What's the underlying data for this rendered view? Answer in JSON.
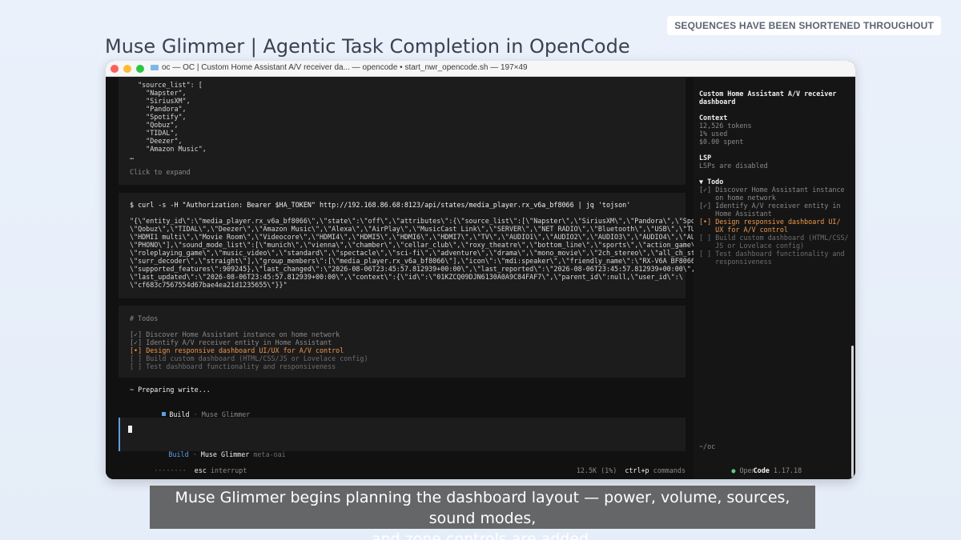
{
  "corner_badge": "SEQUENCES HAVE BEEN SHORTENED THROUGHOUT",
  "page_title": "Muse Glimmer | Agentic Task Completion in OpenCode",
  "window": {
    "title": "oc — OC | Custom Home Assistant A/V receiver da... — opencode • start_nwr_opencode.sh — 197×49"
  },
  "main": {
    "source_block": {
      "lines": "  \"source_list\": [\n    \"Napster\",\n    \"SiriusXM\",\n    \"Pandora\",\n    \"Spotify\",\n    \"Qobuz\",\n    \"TIDAL\",\n    \"Deezer\",\n    \"Amazon Music\",\n…",
      "expand_hint": "Click to expand"
    },
    "curl_block": {
      "command": "$ curl -s -H \"Authorization: Bearer $HA_TOKEN\" http://192.168.86.68:8123/api/states/media_player.rx_v6a_bf8066 | jq 'tojson'",
      "output": "\"{\\\"entity_id\\\":\\\"media_player.rx_v6a_bf8066\\\",\\\"state\\\":\\\"off\\\",\\\"attributes\\\":{\\\"source_list\\\":[\\\"Napster\\\",\\\"SiriusXM\\\",\\\"Pandora\\\",\\\"Spotify\\\",\\\n\\\"Qobuz\\\",\\\"TIDAL\\\",\\\"Deezer\\\",\\\"Amazon Music\\\",\\\"Alexa\\\",\\\"AirPlay\\\",\\\"MusicCast Link\\\",\\\"SERVER\\\",\\\"NET RADIO\\\",\\\"Bluetooth\\\",\\\"USB\\\",\\\"TUNER\\\",\\\n\\\"HDMI1 multi\\\",\\\"Movie Room\\\",\\\"Videocore\\\",\\\"HDMI4\\\",\\\"HDMI5\\\",\\\"HDMI6\\\",\\\"HDMI7\\\",\\\"TV\\\",\\\"AUDIO1\\\",\\\"AUDIO2\\\",\\\"AUDIO3\\\",\\\"AUDIO4\\\",\\\"AUDIO5\\\",\\\n\\\"PHONO\\\"],\\\"sound_mode_list\\\":[\\\"munich\\\",\\\"vienna\\\",\\\"chamber\\\",\\\"cellar_club\\\",\\\"roxy_theatre\\\",\\\"bottom_line\\\",\\\"sports\\\",\\\"action_game\\\",\\\n\\\"roleplaying_game\\\",\\\"music_video\\\",\\\"standard\\\",\\\"spectacle\\\",\\\"sci-fi\\\",\\\"adventure\\\",\\\"drama\\\",\\\"mono_movie\\\",\\\"2ch_stereo\\\",\\\"all_ch_stereo\\\",\\\n\\\"surr_decoder\\\",\\\"straight\\\"],\\\"group_members\\\":[\\\"media_player.rx_v6a_bf8066\\\"],\\\"icon\\\":\\\"mdi:speaker\\\",\\\"friendly_name\\\":\\\"RX-V6A BF8066\\\",\\\n\\\"supported_features\\\":909245},\\\"last_changed\\\":\\\"2026-08-06T23:45:57.812939+00:00\\\",\\\"last_reported\\\":\\\"2026-08-06T23:45:57.812939+00:00\\\",\\\n\\\"last_updated\\\":\\\"2026-08-06T23:45:57.812939+00:00\\\",\\\"context\\\":{\\\"id\\\":\\\"01KZCQ09DJN6130A0A9C84FAF7\\\",\\\"parent_id\\\":null,\\\"user_id\\\":\\\n\\\"cf683c7567554d67bae4ea21d1235655\\\"}}\""
    },
    "todos_block": {
      "heading": "# Todos",
      "items": [
        {
          "mark": "[✓]",
          "text": "Discover Home Assistant instance on home network"
        },
        {
          "mark": "[✓]",
          "text": "Identify A/V receiver entity in Home Assistant"
        },
        {
          "mark": "[•]",
          "text": "Design responsive dashboard UI/UX for A/V control"
        },
        {
          "mark": "[ ]",
          "text": "Build custom dashboard (HTML/CSS/JS or Lovelace config)"
        },
        {
          "mark": "[ ]",
          "text": "Test dashboard functionality and responsiveness"
        }
      ]
    },
    "preparing": "~ Preparing write...",
    "build_status": {
      "mode": "Build",
      "separator": "·",
      "model": "Muse Glimmer"
    },
    "prompt": {
      "mode": "Build",
      "separator": "·",
      "model": "Muse Glimmer",
      "provider": "meta-oai"
    },
    "footer": {
      "spinner": "········",
      "key": "esc",
      "action": "interrupt",
      "usage": "12.5K (1%)",
      "shortcut": "ctrl+p",
      "shortcut_label": "commands"
    }
  },
  "sidebar": {
    "title": "Custom Home Assistant A/V receiver\ndashboard",
    "context": {
      "heading": "Context",
      "tokens": "12,526 tokens",
      "used": "1% used",
      "spent": "$0.00 spent"
    },
    "lsp": {
      "heading": "LSP",
      "status": "LSPs are disabled"
    },
    "todo": {
      "heading": "▼ Todo",
      "items": [
        {
          "mark": "[✓]",
          "text": "Discover Home Assistant instance\n    on home network"
        },
        {
          "mark": "[✓]",
          "text": "Identify A/V receiver entity in\n    Home Assistant"
        },
        {
          "mark": "[•]",
          "text": "Design responsive dashboard UI/\n    UX for A/V control"
        },
        {
          "mark": "[ ]",
          "text": "Build custom dashboard (HTML/CSS/\n    JS or Lovelace config)"
        },
        {
          "mark": "[ ]",
          "text": "Test dashboard functionality and\n    responsiveness"
        }
      ]
    },
    "cwd": "~/oc",
    "brand_open": "Open",
    "brand_code": "Code",
    "version": "1.17.18"
  },
  "subtitle": "Muse Glimmer begins planning the dashboard layout — power, volume, sources, sound modes,\nand zone controls are added.",
  "colors": {
    "accent_orange": "#f0984a",
    "accent_blue": "#5aa0e6",
    "status_green": "#5fcf7a"
  }
}
